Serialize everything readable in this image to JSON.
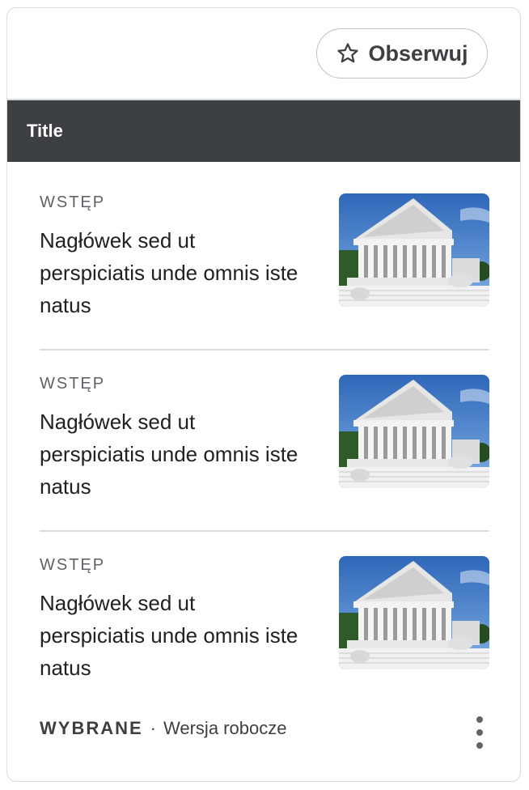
{
  "header": {
    "follow_label": "Obserwuj",
    "follow_icon": "star-outline-icon"
  },
  "section": {
    "title": "Title"
  },
  "articles": [
    {
      "kicker": "WSTĘP",
      "headline": "Nagłówek sed ut perspiciatis unde omnis iste natus",
      "image": "courthouse-photo"
    },
    {
      "kicker": "WSTĘP",
      "headline": "Nagłówek sed ut perspiciatis unde omnis iste natus",
      "image": "courthouse-photo"
    },
    {
      "kicker": "WSTĘP",
      "headline": "Nagłówek sed ut perspiciatis unde omnis iste natus",
      "image": "courthouse-photo"
    }
  ],
  "footer": {
    "status_bold": "WYBRANE",
    "separator": "·",
    "status_text": "Wersja robocze",
    "more_icon": "more-vert-icon"
  },
  "colors": {
    "title_bar_bg": "#3c4043",
    "text": "#202124",
    "muted": "#5f6368",
    "border": "#dadce0"
  }
}
